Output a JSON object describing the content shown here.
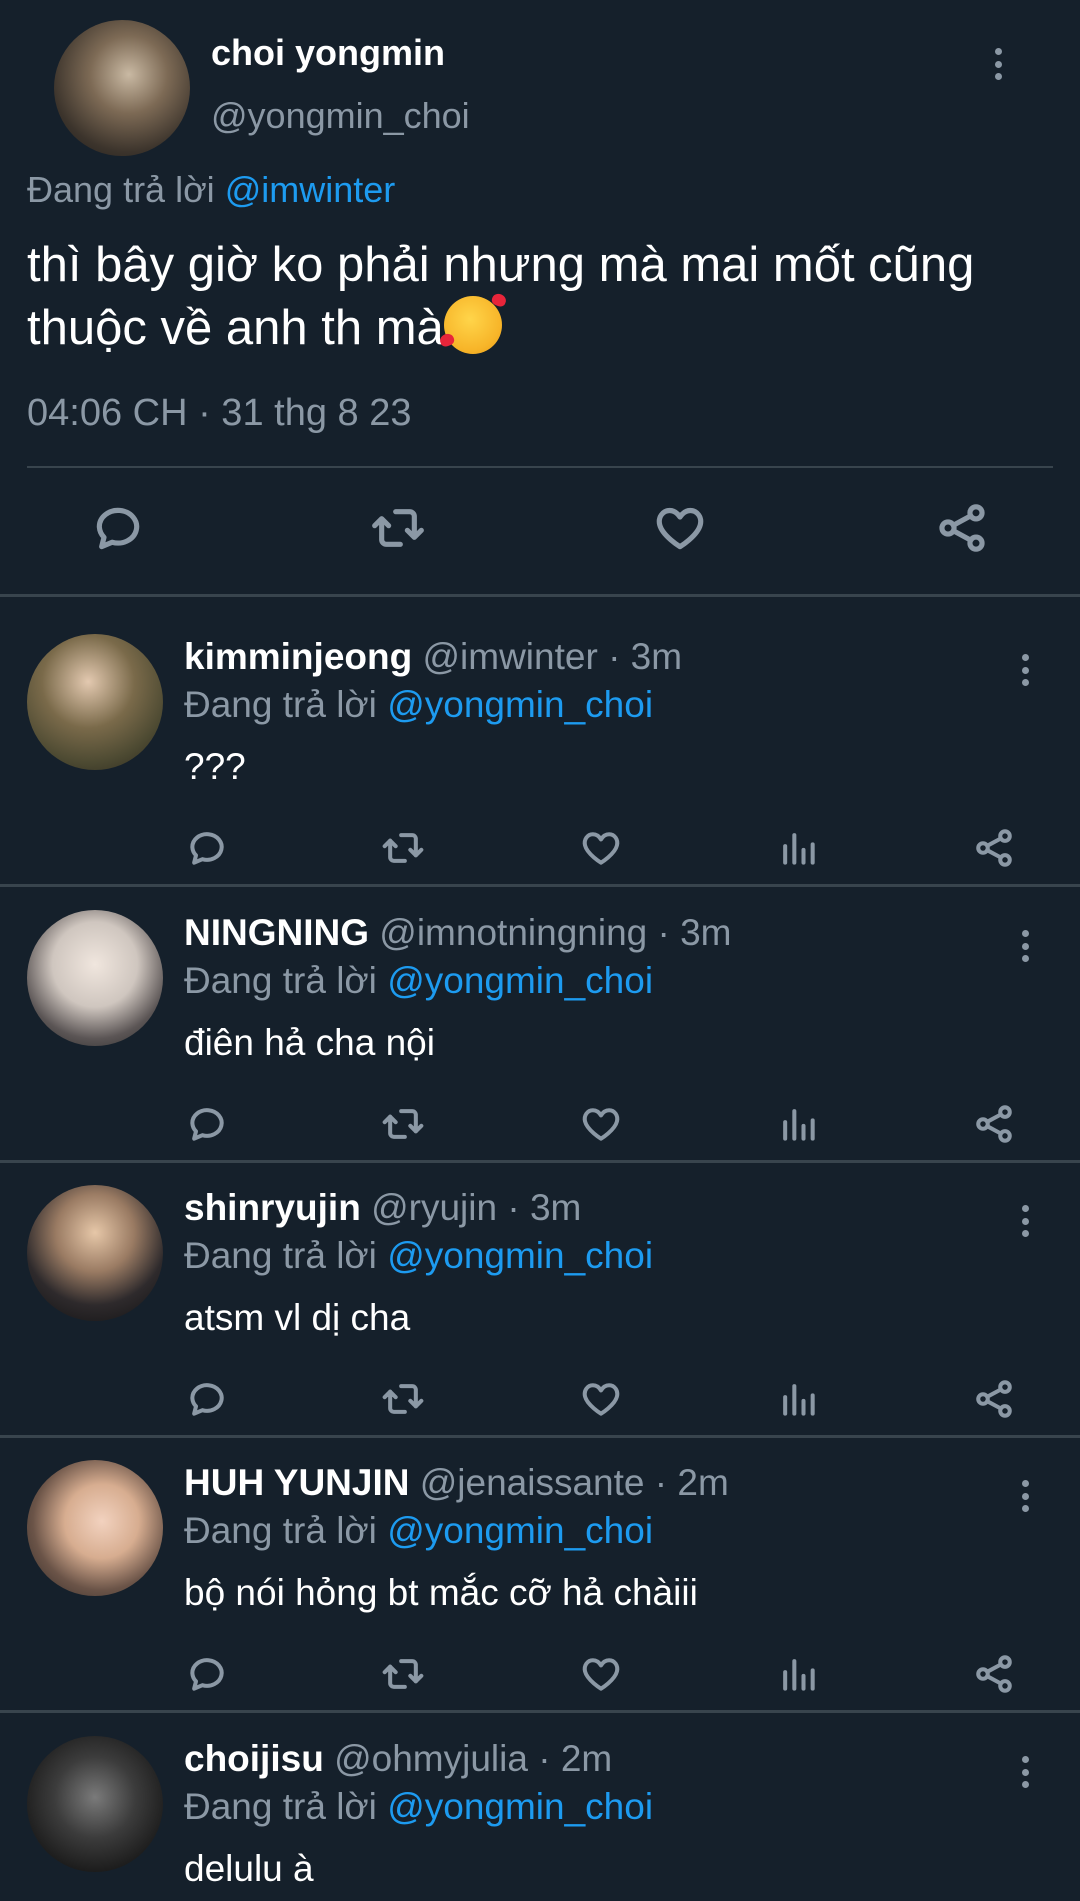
{
  "main_tweet": {
    "author_name": "choi yongmin",
    "author_handle": "@yongmin_choi",
    "replying_prefix": "Đang trả lời",
    "replying_mention": "@imwinter",
    "text": "thì bây giờ ko phải nhưng mà mai mốt cũng thuộc về anh th mà",
    "emoji_icon": "smiling-face-with-hearts-icon",
    "timestamp": "04:06 CH · 31 thg 8 23",
    "actions": [
      "reply-icon",
      "retweet-icon",
      "like-icon",
      "share-icon"
    ]
  },
  "replies": [
    {
      "name": "kimminjeong",
      "meta": "@imwinter · 3m",
      "replying_prefix": "Đang trả lời",
      "replying_mention": "@yongmin_choi",
      "text": "???"
    },
    {
      "name": "NINGNING",
      "meta": "@imnotningning · 3m",
      "replying_prefix": "Đang trả lời",
      "replying_mention": "@yongmin_choi",
      "text": "điên hả cha nội"
    },
    {
      "name": "shinryujin",
      "meta": "@ryujin · 3m",
      "replying_prefix": "Đang trả lời",
      "replying_mention": "@yongmin_choi",
      "text": "atsm vl dị cha"
    },
    {
      "name": "HUH YUNJIN",
      "meta": "@jenaissante · 2m",
      "replying_prefix": "Đang trả lời",
      "replying_mention": "@yongmin_choi",
      "text": "bộ nói hỏng bt mắc cỡ hả chàiii"
    },
    {
      "name": "choijisu",
      "meta": "@ohmyjulia · 2m",
      "replying_prefix": "Đang trả lời",
      "replying_mention": "@yongmin_choi",
      "text": "delulu à"
    }
  ],
  "colors": {
    "background": "#15202b",
    "divider": "#38444d",
    "secondary_text": "#8b98a5",
    "mention": "#1d9bf0"
  }
}
